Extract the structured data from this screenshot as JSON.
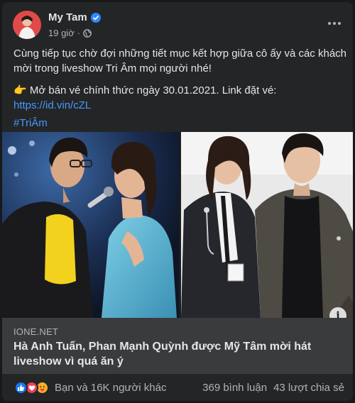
{
  "post": {
    "author": "My Tam",
    "time": "19 giờ",
    "text_line1": "Cùng tiếp tục chờ đợi những tiết mục kết hợp giữa cô ấy và các khách",
    "text_line2": "mời trong liveshow Tri Âm mọi người nhé!",
    "ticket_emoji": "👉",
    "ticket_text": " Mở bán vé chính thức ngày 30.01.2021. Link đặt vé:",
    "ticket_link": "https://id.vin/cZL",
    "hashtag": "#TriÂm"
  },
  "link_preview": {
    "domain": "IONE.NET",
    "headline": "Hà Anh Tuấn, Phan Mạnh Quỳnh được Mỹ Tâm mời hát liveshow vì quá ăn ý"
  },
  "footer": {
    "reactions_text": "Bạn và 16K người khác",
    "comments": "369 bình luận",
    "shares": "43 lượt chia sẻ"
  },
  "colors": {
    "background": "#18191a",
    "card": "#242526",
    "link": "#4599ff",
    "preview_bg": "#3a3b3c"
  },
  "icons": [
    "verified-badge-icon",
    "globe-icon",
    "more-options-icon",
    "info-icon",
    "like-reaction-icon",
    "love-reaction-icon",
    "care-reaction-icon"
  ]
}
